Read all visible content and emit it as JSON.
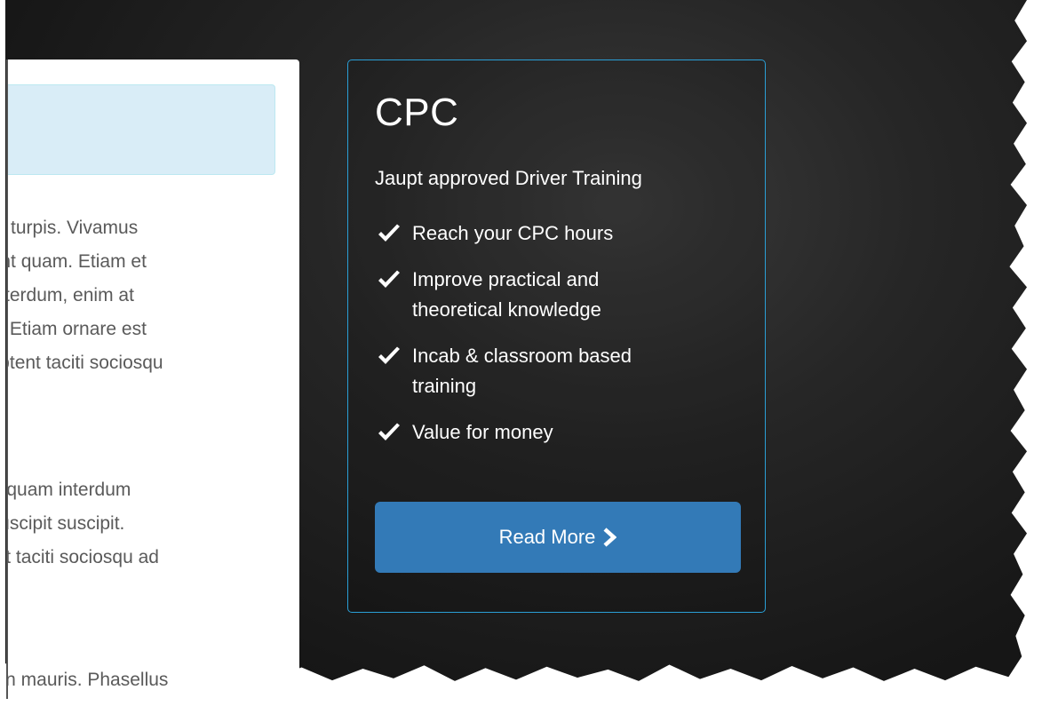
{
  "left_panel": {
    "paragraph_1": [
      "o a turpis. Vivamus",
      "dunt quam. Etiam et",
      "t interdum, enim at",
      "us. Etiam ornare est",
      "i aptent taciti sociosqu"
    ],
    "paragraph_2": [
      "tor quam interdum",
      "t suscipit suscipit.",
      "tent taciti sociosqu ad"
    ],
    "paragraph_3": [
      "or in mauris. Phasellus"
    ]
  },
  "card": {
    "title": "CPC",
    "subtitle": "Jaupt approved Driver Training",
    "features": [
      {
        "line1": "Reach your CPC hours",
        "line2": ""
      },
      {
        "line1": "Improve practical and",
        "line2": "theoretical knowledge"
      },
      {
        "line1": "Incab & classroom based",
        "line2": "training"
      },
      {
        "line1": "Value for money",
        "line2": ""
      }
    ],
    "button_label": "Read More",
    "check_icon": "check-icon",
    "chevron_icon": "chevron-right-icon",
    "accent_color": "#2a9fd6",
    "button_color": "#337ab7"
  }
}
